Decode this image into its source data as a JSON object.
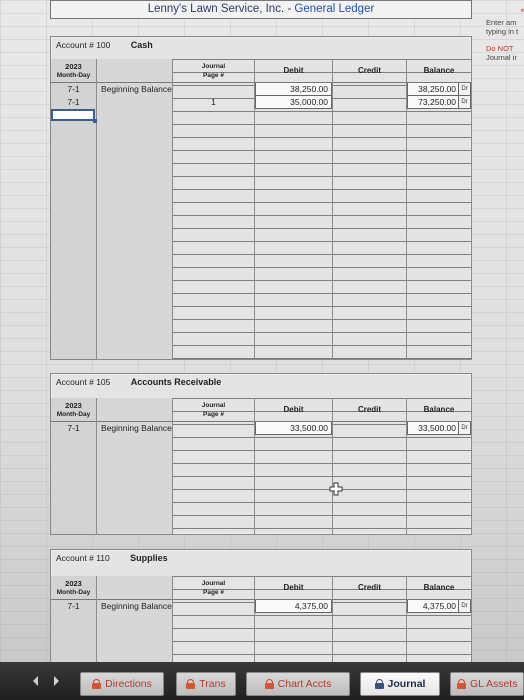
{
  "title": {
    "company": "Lenny's Lawn Service, Inc.",
    "separator": " - ",
    "ledger": "General Ledger"
  },
  "side_note": {
    "line1": "Enter am",
    "line2": "typing in t",
    "line3": "Do NOT",
    "line4": "Journal ir"
  },
  "columns": {
    "year": "2023",
    "month_day": "Month-Day",
    "journal_line1": "Journal",
    "journal_line2": "Page #",
    "debit": "Debit",
    "credit": "Credit",
    "balance": "Balance"
  },
  "accounts": [
    {
      "label": "Account #",
      "number": "100",
      "name": "Cash",
      "rows": [
        {
          "date": "7-1",
          "desc": "Beginning Balance",
          "page": "",
          "debit": "38,250.00",
          "credit": "",
          "balance": "38,250.00",
          "side": "Dr"
        },
        {
          "date": "7-1",
          "desc": "",
          "page": "1",
          "debit": "35,000.00",
          "credit": "",
          "balance": "73,250.00",
          "side": "Dr"
        }
      ]
    },
    {
      "label": "Account #",
      "number": "105",
      "name": "Accounts Receivable",
      "rows": [
        {
          "date": "7-1",
          "desc": "Beginning Balance",
          "page": "",
          "debit": "33,500.00",
          "credit": "",
          "balance": "33,500.00",
          "side": "Dr"
        }
      ]
    },
    {
      "label": "Account #",
      "number": "110",
      "name": "Supplies",
      "rows": [
        {
          "date": "7-1",
          "desc": "Beginning Balance",
          "page": "",
          "debit": "4,375.00",
          "credit": "",
          "balance": "4,375.00",
          "side": "Dr"
        }
      ]
    }
  ],
  "tabs": [
    {
      "label": "Directions",
      "active": false
    },
    {
      "label": "Trans",
      "active": false
    },
    {
      "label": "Chart Accts",
      "active": false
    },
    {
      "label": "Journal",
      "active": true
    },
    {
      "label": "GL Assets",
      "active": false
    }
  ],
  "colors": {
    "title_text": "#2050b8",
    "tab_text": "#b23a2e",
    "selection": "#3b5b95"
  }
}
